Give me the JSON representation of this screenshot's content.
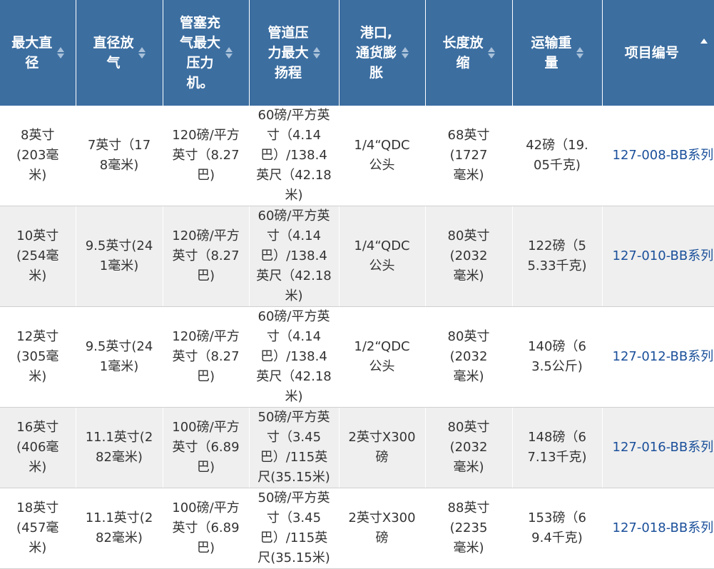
{
  "table": {
    "headers": [
      {
        "label": "最大直径",
        "sorted": false
      },
      {
        "label": "直径放气",
        "sorted": false
      },
      {
        "label": "管塞充气最大压力机。",
        "sorted": false
      },
      {
        "label": "管道压力最大扬程",
        "sorted": false
      },
      {
        "label": "港口,通货膨胀",
        "sorted": false
      },
      {
        "label": "长度放缩",
        "sorted": false
      },
      {
        "label": "运输重量",
        "sorted": false
      },
      {
        "label": "项目编号",
        "sorted": true,
        "direction": "asc"
      }
    ],
    "rows": [
      [
        "8英寸(203毫米)",
        "7英寸（178毫米)",
        "120磅/平方英寸（8.27巴)",
        "60磅/平方英寸（4.14巴）/138.4英尺（42.18米)",
        "1/4“QDC公头",
        "68英寸(1727毫米)",
        "42磅（19.05千克)",
        "127-008-BB系列"
      ],
      [
        "10英寸(254毫米)",
        "9.5英寸(241毫米)",
        "120磅/平方英寸（8.27巴)",
        "60磅/平方英寸（4.14巴）/138.4英尺（42.18米)",
        "1/4“QDC公头",
        "80英寸(2032毫米)",
        "122磅（55.33千克)",
        "127-010-BB系列"
      ],
      [
        "12英寸(305毫米)",
        "9.5英寸(241毫米)",
        "120磅/平方英寸（8.27巴)",
        "60磅/平方英寸（4.14巴）/138.4英尺（42.18米)",
        "1/2“QDC公头",
        "80英寸(2032毫米)",
        "140磅（63.5公斤)",
        "127-012-BB系列"
      ],
      [
        "16英寸(406毫米)",
        "11.1英寸(282毫米)",
        "100磅/平方英寸（6.89巴)",
        "50磅/平方英寸（3.45巴）/115英尺(35.15米)",
        "2英寸X300磅",
        "80英寸(2032毫米)",
        "148磅（67.13千克)",
        "127-016-BB系列"
      ],
      [
        "18英寸(457毫米)",
        "11.1英寸(282毫米)",
        "100磅/平方英寸（6.89巴)",
        "50磅/平方英寸（3.45巴）/115英尺(35.15米)",
        "2英寸X300磅",
        "88英寸(2235毫米)",
        "153磅（69.4千克)",
        "127-018-BB系列"
      ]
    ]
  },
  "colors": {
    "header_bg": "#3c6ea0",
    "header_text": "#ffffff",
    "row_alt_bg": "#efefef",
    "link": "#1a4f9a"
  },
  "icons": {
    "sort": "sort-arrows-icon",
    "sort_active": "sort-ascending-icon"
  }
}
